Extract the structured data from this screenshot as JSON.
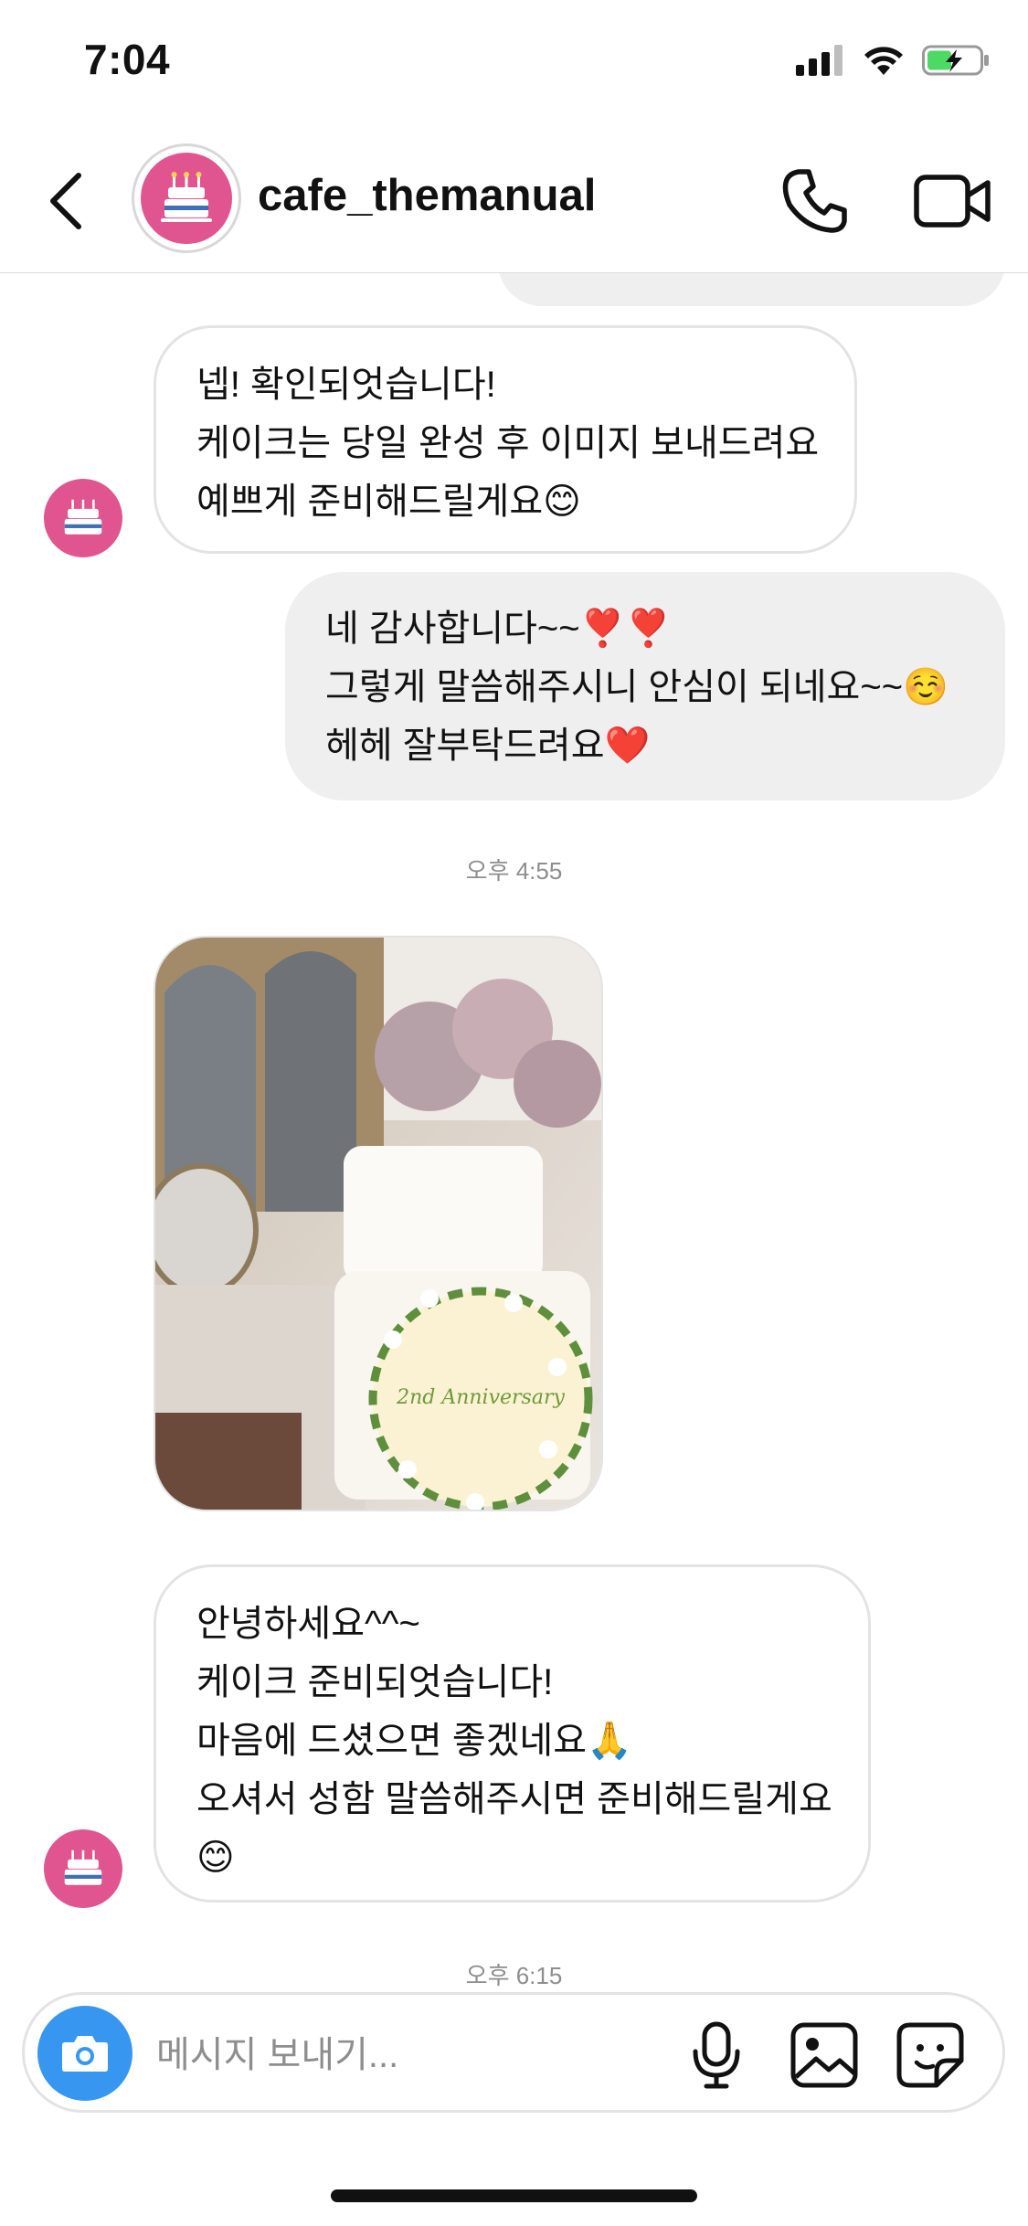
{
  "status_bar": {
    "time": "7:04"
  },
  "header": {
    "username": "cafe_themanual"
  },
  "messages": {
    "m1": {
      "lines": [
        "넵! 확인되엇습니다!",
        "케이크는 당일 완성 후 이미지 보내드려요",
        "예쁘게 준비해드릴게요"
      ],
      "emoji": "😊"
    },
    "m2": {
      "lines": [
        "네 감사합니다~~",
        "그렇게 말씀해주시니 안심이 되네요~~",
        "헤헤 잘부탁드려요"
      ],
      "emoji": [
        "❣️❣️",
        "☺️",
        "❤️"
      ]
    },
    "ts1": "오후 4:55",
    "photo": {
      "cake_text": "2nd Anniversary"
    },
    "m3": {
      "lines": [
        "안녕하세요^^~",
        "케이크 준비되엇습니다!",
        "마음에 드셨으면 좋겠네요",
        "오셔서 성함 말씀해주시면 준비해드릴게요"
      ],
      "emoji": [
        "🙏",
        "😊"
      ]
    },
    "ts2": "오후 6:15"
  },
  "composer": {
    "placeholder": "메시지 보내기..."
  },
  "colors": {
    "accent": "#3797f0",
    "avatar_pink": "#e0558f",
    "bubble_out": "#efefef"
  }
}
